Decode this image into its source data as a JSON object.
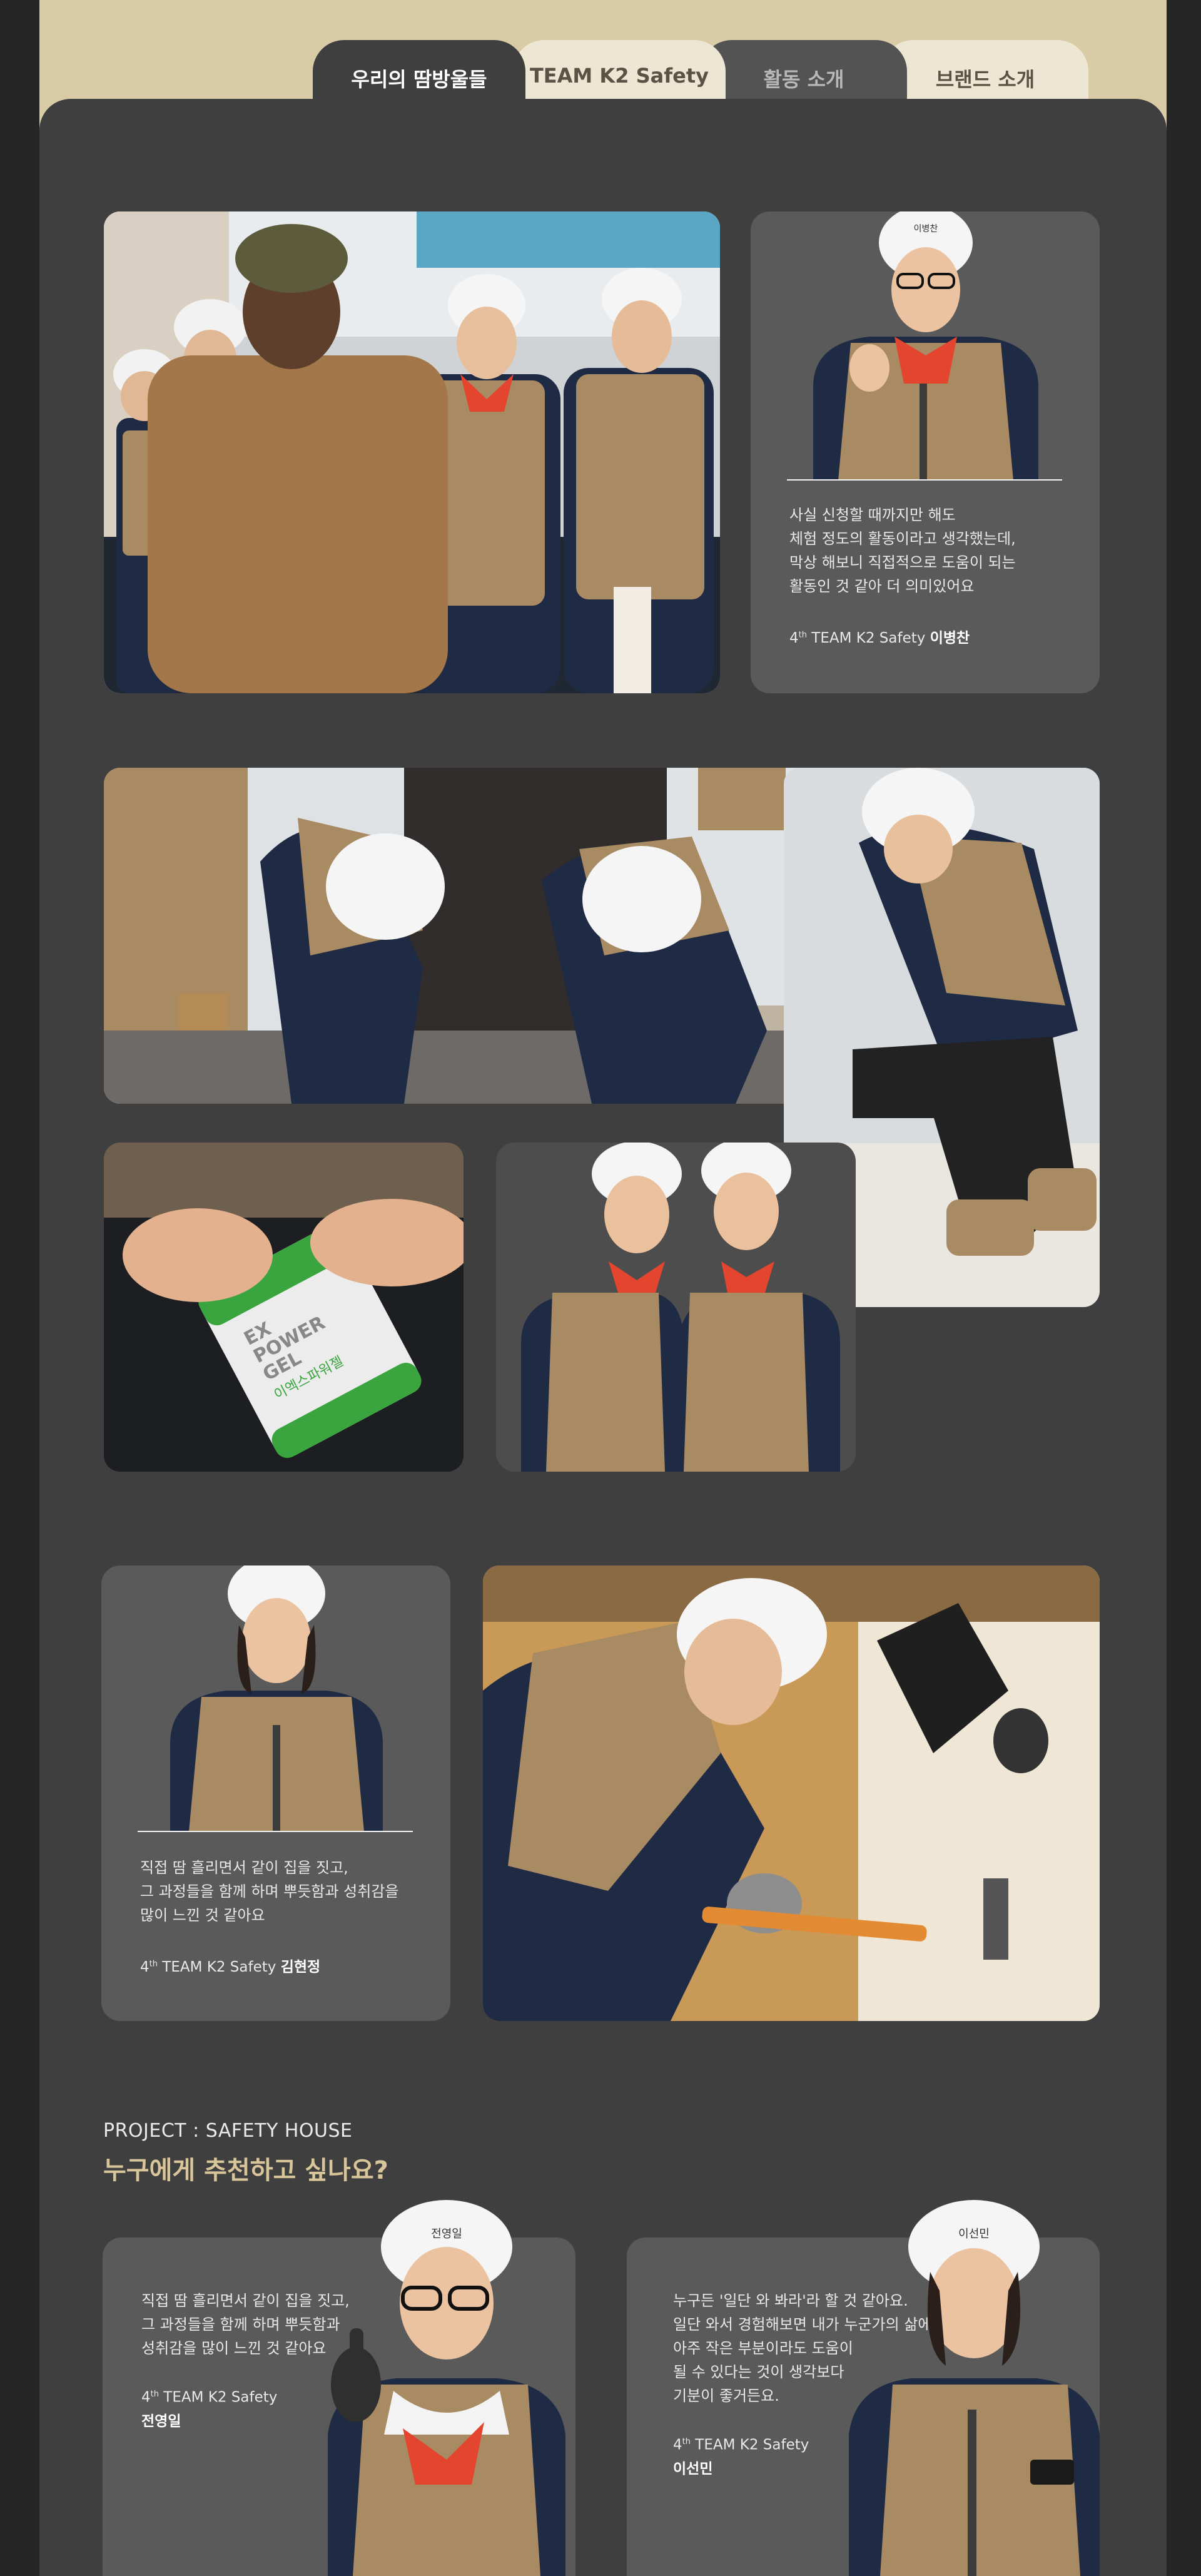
{
  "tabs": [
    {
      "label": "우리의 땀방울들",
      "active": true
    },
    {
      "label": "TEAM K2 Safety",
      "active": false
    },
    {
      "label": "활동 소개",
      "active": false
    },
    {
      "label": "브랜드 소개",
      "active": false
    }
  ],
  "testimonial_1": {
    "quote": "사실 신청할 때까지만 해도\n체험 정도의 활동이라고 생각했는데,\n막상 해보니 직접적으로 도움이 되는\n활동인 것 같아 더 의미있어요",
    "gen": "4",
    "gen_suffix": "th",
    "team": " TEAM K2 Safety ",
    "name": "이병찬",
    "helmet_name": "이병찬"
  },
  "testimonial_2": {
    "quote": "직접 땀 흘리면서 같이 집을 짓고,\n그 과정들을 함께 하며 뿌듯함과 성취감을\n많이 느낀 것 같아요",
    "gen": "4",
    "gen_suffix": "th",
    "team": " TEAM K2 Safety ",
    "name": "김현정"
  },
  "pouch": {
    "brand_line1": "EX",
    "brand_line2": "POWER",
    "brand_line3": "GEL",
    "korean": "이엑스파워젤"
  },
  "project": {
    "label": "PROJECT : SAFETY HOUSE",
    "title": "누구에게 추천하고 싶나요?"
  },
  "recommend_1": {
    "quote": "직접 땀 흘리면서 같이 집을 짓고,\n그 과정들을 함께 하며 뿌듯함과\n성취감을 많이 느낀 것 같아요",
    "gen": "4",
    "gen_suffix": "th",
    "team": " TEAM K2 Safety",
    "name": "전영일",
    "helmet_name": "전영일"
  },
  "recommend_2": {
    "quote": "누구든 '일단 와 봐라'라 할 것 같아요.\n일단 와서 경험해보면 내가 누군가의 삶에\n아주 작은 부분이라도 도움이\n될 수 있다는 것이 생각보다\n기분이 좋거든요.",
    "gen": "4",
    "gen_suffix": "th",
    "team": " TEAM K2 Safety",
    "name": "이선민",
    "helmet_name": "이선민"
  },
  "colors": {
    "panel": "#3f3f3f",
    "card": "#5a5a5a",
    "accent": "#d8c59a",
    "header_bg": "#d8cba6",
    "vest": "#a88a63",
    "navy": "#1f2a44"
  }
}
